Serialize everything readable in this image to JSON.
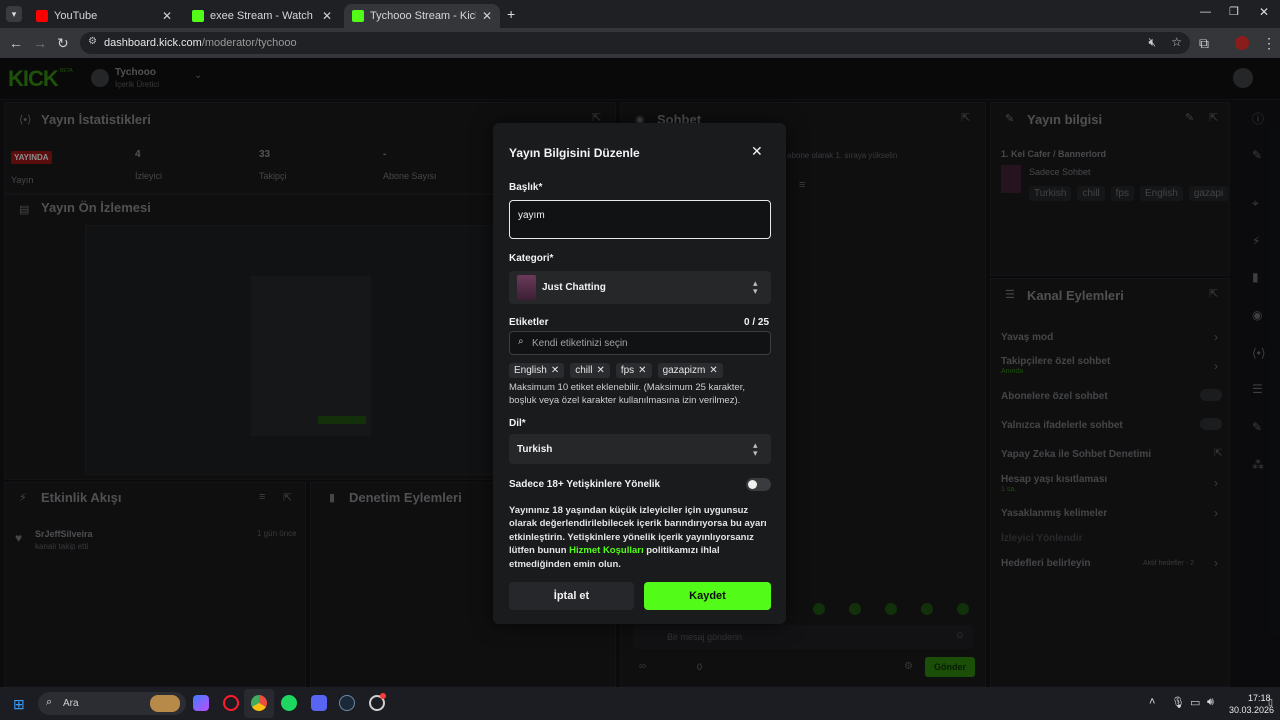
{
  "browser": {
    "tabs": [
      {
        "label": "YouTube",
        "color": "#ff0000"
      },
      {
        "label": "exee Stream - Watch Live on Kic",
        "color": "#53fc18"
      },
      {
        "label": "Tychooo Stream - Kick Dash",
        "color": "#53fc18"
      }
    ],
    "url_host": "dashboard.kick.com",
    "url_path": "/moderator/tychooo"
  },
  "header": {
    "logo": "KICK",
    "logo_badge": "BETA",
    "channel_name": "Tychooo",
    "channel_role": "İçerik Üretici"
  },
  "stats_panel": {
    "title": "Yayın İstatistikleri",
    "live_badge": "YAYINDA",
    "live_label": "Yayın",
    "stats": [
      {
        "value": "4",
        "label": "İzleyici"
      },
      {
        "value": "33",
        "label": "Takipçi"
      },
      {
        "value": "-",
        "label": "Abone Sayısı"
      }
    ]
  },
  "preview_panel": {
    "title": "Yayın Ön İzlemesi"
  },
  "activity_panel": {
    "title": "Etkinlik Akışı",
    "item_user": "SrJeffSilveira",
    "item_text": "kanalı takip etti",
    "item_time": "1 gün önce"
  },
  "moderation_panel": {
    "title": "Denetim Eylemleri"
  },
  "chat_panel": {
    "title": "Sohbet",
    "hint": "abone olarak 1. sıraya yükselin",
    "input_placeholder": "Bir mesaj gönderin",
    "viewers": "0",
    "send_label": "Gönder"
  },
  "stream_info_panel": {
    "title": "Yayın bilgisi",
    "stream_title": "1. Kel Cafer / Bannerlord",
    "category": "Sadece Sohbet",
    "tags": [
      "Turkish",
      "chill",
      "fps",
      "English",
      "gazapi"
    ]
  },
  "channel_actions_panel": {
    "title": "Kanal Eylemleri",
    "rows": [
      {
        "label": "Yavaş mod",
        "sub": ""
      },
      {
        "label": "Takipçilere özel sohbet",
        "sub": "Anında"
      },
      {
        "label": "Abonelere özel sohbet",
        "sub": ""
      },
      {
        "label": "Yalnızca ifadelerle sohbet",
        "sub": ""
      },
      {
        "label": "Yapay Zeka ile Sohbet Denetimi",
        "sub": ""
      },
      {
        "label": "Hesap yaşı kısıtlaması",
        "sub": "1 sa."
      },
      {
        "label": "Yasaklanmış kelimeler",
        "sub": ""
      },
      {
        "label": "İzleyici Yönlendir",
        "sub": ""
      },
      {
        "label": "Hedefleri belirleyin",
        "sub": ""
      }
    ],
    "goals_status": "Aktif hedefler - 2"
  },
  "modal": {
    "title": "Yayın Bilgisini Düzenle",
    "title_label": "Başlık*",
    "title_value": "yayım",
    "category_label": "Kategori*",
    "category_value": "Just Chatting",
    "tags_label": "Etiketler",
    "tags_counter": "0 / 25",
    "tags_placeholder": "Kendi etiketinizi seçin",
    "tags": [
      "English",
      "chill",
      "fps",
      "gazapizm"
    ],
    "tags_help": "Maksimum 10 etiket eklenebilir. (Maksimum 25 karakter, boşluk veya özel karakter kullanılmasına izin verilmez).",
    "language_label": "Dil*",
    "language_value": "Turkish",
    "adult_label": "Sadece 18+ Yetişkinlere Yönelik",
    "adult_toggle_on": false,
    "adult_help_before": "Yayınınız 18 yaşından küçük izleyiciler için uygunsuz olarak değerlendirilebilecek içerik barındırıyorsa bu ayarı etkinleştirin. Yetişkinlere yönelik içerik yayınlıyorsanız lütfen bunun ",
    "adult_help_link": "Hizmet Koşulları",
    "adult_help_after": " politikamızı ihlal etmediğinden emin olun.",
    "cancel_label": "İptal et",
    "save_label": "Kaydet",
    "accent": "#53fc18"
  },
  "taskbar": {
    "search_label": "Ara",
    "time": "17:18",
    "date": "30.03.2026"
  }
}
